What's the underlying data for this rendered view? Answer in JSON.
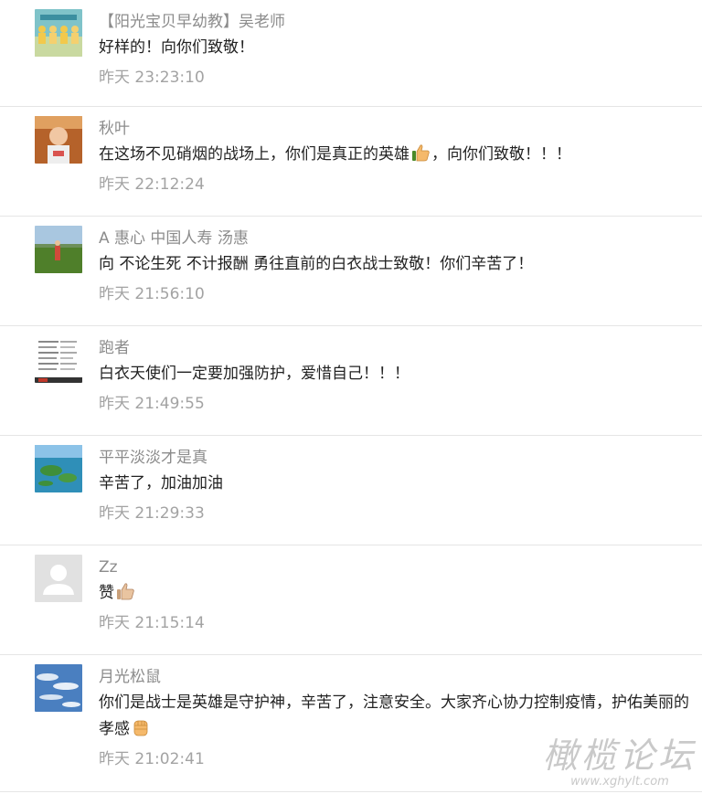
{
  "comments": [
    {
      "author": "【阳光宝贝早幼教】吴老师",
      "text": "好样的！向你们致敬！",
      "time": "昨天 23:23:10",
      "avatar": "group-photo-avatar"
    },
    {
      "author": "秋叶",
      "text_before": "在这场不见硝烟的战场上，你们是真正的英雄",
      "emoji": "thumbs-up-icon",
      "text_after": "，向你们致敬！！！",
      "time": "昨天 22:12:24",
      "avatar": "child-photo-avatar"
    },
    {
      "author": "A 惠心 中国人寿 汤惠",
      "text": "向 不论生死 不计报酬 勇往直前的白衣战士致敬！你们辛苦了！",
      "time": "昨天 21:56:10",
      "avatar": "field-photo-avatar"
    },
    {
      "author": "跑者",
      "text": "白衣天使们一定要加强防护，爱惜自己！！！",
      "time": "昨天 21:49:55",
      "avatar": "document-avatar"
    },
    {
      "author": "平平淡淡才是真",
      "text": "辛苦了，加油加油",
      "time": "昨天 21:29:33",
      "avatar": "island-photo-avatar"
    },
    {
      "author": "Zz",
      "text_before": "赞",
      "emoji": "thumbs-up-icon",
      "text_after": "",
      "time": "昨天 21:15:14",
      "avatar": "default-user-avatar"
    },
    {
      "author": "月光松鼠",
      "text_before": "你们是战士是英雄是守护神，辛苦了，注意安全。大家齐心协力控制疫情，护佑美丽的孝感",
      "emoji": "fist-icon",
      "text_after": "",
      "time": "昨天 21:02:41",
      "avatar": "sky-photo-avatar"
    }
  ],
  "watermark": {
    "main": "橄榄论坛",
    "url": "www.xghylt.com"
  },
  "colors": {
    "author": "#8c8c8c",
    "text": "#222222",
    "time": "#a3a3a3",
    "divider": "#e5e5e5"
  }
}
